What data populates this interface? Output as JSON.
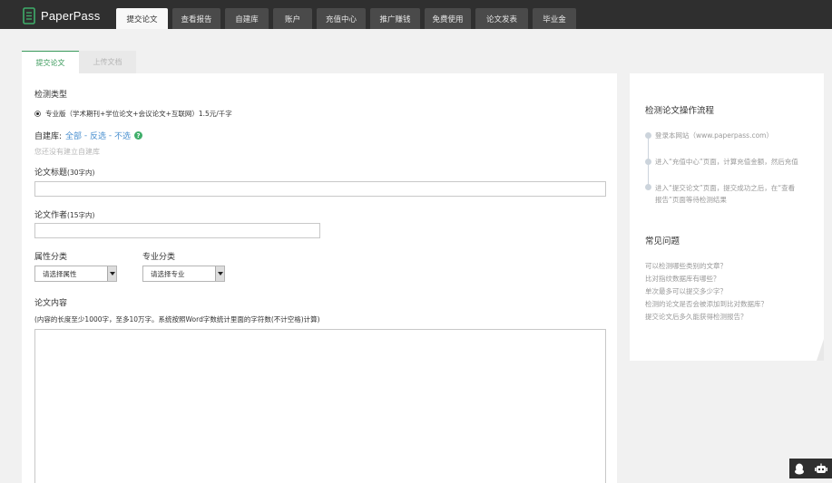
{
  "app": {
    "logo_text": "PaperPass"
  },
  "nav": {
    "items": [
      {
        "label": "提交论文",
        "active": true
      },
      {
        "label": "查看报告"
      },
      {
        "label": "自建库"
      },
      {
        "label": "账户"
      },
      {
        "label": "充值中心"
      },
      {
        "label": "推广赚钱"
      },
      {
        "label": "免费使用"
      },
      {
        "label": "论文发表"
      },
      {
        "label": "毕业金"
      }
    ]
  },
  "tabs": {
    "submit": "提交论文",
    "upload": "上传文档"
  },
  "form": {
    "detect_type_label": "检测类型",
    "detect_option": "专业版（学术期刊+学位论文+会议论文+互联网）1.5元/千字",
    "library_label": "自建库:",
    "library_all": "全部",
    "library_invert": "反选",
    "library_none": "不选",
    "library_sep1": " - ",
    "library_sep2": " - ",
    "library_empty": "您还没有建立自建库",
    "title_label": "论文标题",
    "title_limit": "(30字内)",
    "author_label": "论文作者",
    "author_limit": "(15字内)",
    "attr_label": "属性分类",
    "major_label": "专业分类",
    "attr_select": "请选择属性",
    "major_select": "请选择专业",
    "content_label": "论文内容",
    "content_hint": "(内容的长度至少1000字，至多10万字。系统按照Word字数统计里面的字符数(不计空格)计算)"
  },
  "side": {
    "process_title": "检测论文操作流程",
    "steps": [
      "登录本网站（www.paperpass.com）",
      "进入“充值中心”页面，计算充值金额，然后充值",
      "进入“提交论文”页面，提交成功之后，在“查看",
      "报告”页面等待检测结果"
    ],
    "faq_title": "常见问题",
    "faqs": [
      "可以检测哪些类别的文章？",
      "比对指纹数据库有哪些？",
      "单次最多可以提交多少字？",
      "检测的论文是否会被添加到比对数据库？",
      "提交论文后多久能获得检测报告？"
    ]
  }
}
